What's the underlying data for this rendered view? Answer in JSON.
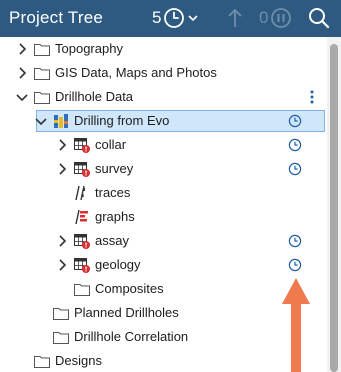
{
  "header": {
    "title": "Project Tree",
    "pending_tasks_count": "5",
    "paused_tasks_count": "0"
  },
  "icons": {
    "clock": "clock-icon",
    "search": "search-icon",
    "upload": "upload-arrow-icon",
    "pause": "pause-icon"
  },
  "colors": {
    "header_bg": "#2e5a82",
    "selection_bg": "#cfe6fb",
    "accent_blue": "#1f5fa8",
    "annotation_arrow": "#ee7a4e"
  },
  "tree": {
    "items": [
      {
        "label": "Topography",
        "icon": "folder",
        "expandable": true,
        "expanded": false
      },
      {
        "label": "GIS Data, Maps and Photos",
        "icon": "folder",
        "expandable": true,
        "expanded": false
      },
      {
        "label": "Drillhole Data",
        "icon": "folder",
        "expandable": true,
        "expanded": true,
        "has_menu": true
      },
      {
        "label": "Drilling from Evo",
        "icon": "drillhole-database",
        "expandable": true,
        "expanded": true,
        "selected": true,
        "has_clock": true
      },
      {
        "label": "collar",
        "icon": "table-error",
        "expandable": true,
        "expanded": false,
        "has_clock": true
      },
      {
        "label": "survey",
        "icon": "table-error",
        "expandable": true,
        "expanded": false,
        "has_clock": true
      },
      {
        "label": "traces",
        "icon": "traces",
        "expandable": false
      },
      {
        "label": "graphs",
        "icon": "graphs",
        "expandable": false
      },
      {
        "label": "assay",
        "icon": "table-error",
        "expandable": true,
        "expanded": false,
        "has_clock": true
      },
      {
        "label": "geology",
        "icon": "table-error",
        "expandable": true,
        "expanded": false,
        "has_clock": true
      },
      {
        "label": "Composites",
        "icon": "folder",
        "expandable": false
      },
      {
        "label": "Planned Drillholes",
        "icon": "folder",
        "expandable": false
      },
      {
        "label": "Drillhole Correlation",
        "icon": "folder",
        "expandable": false
      },
      {
        "label": "Designs",
        "icon": "folder",
        "expandable": false
      }
    ]
  }
}
